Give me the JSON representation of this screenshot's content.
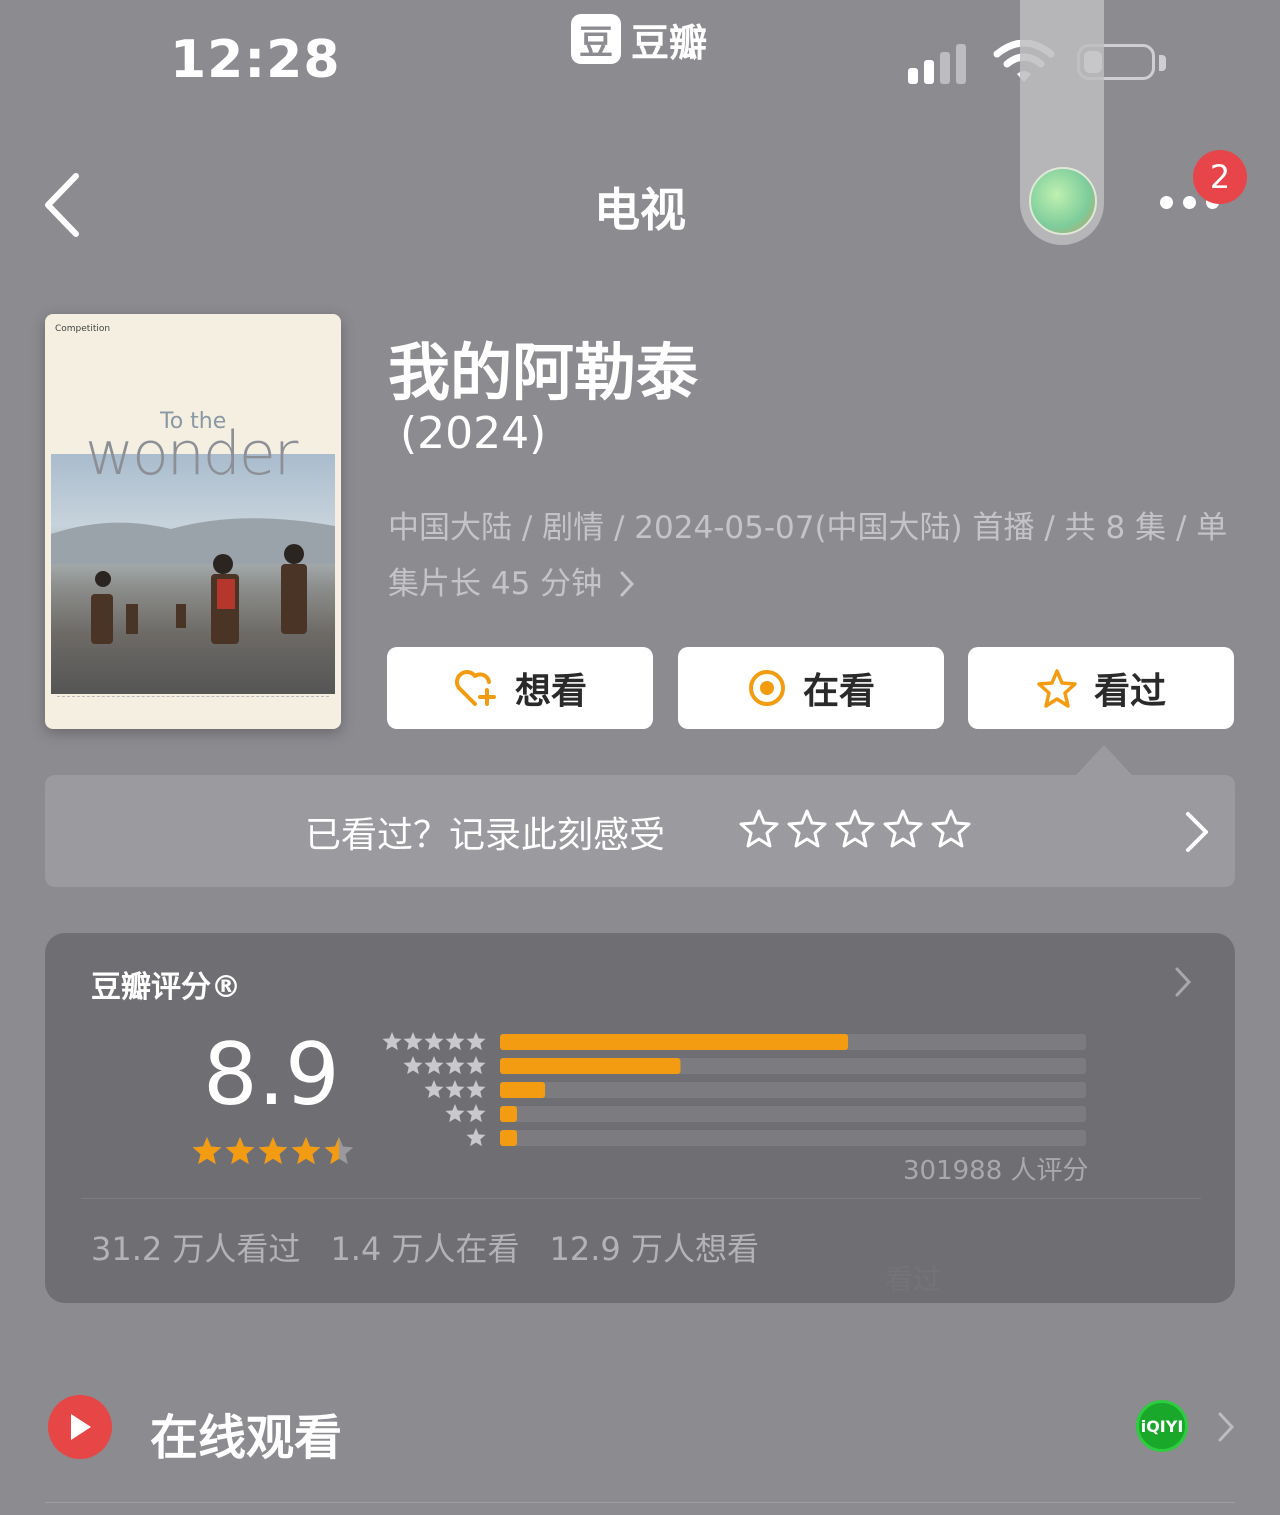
{
  "status_bar": {
    "time": "12:28",
    "app_logo": "豆",
    "app_name": "豆瓣"
  },
  "nav": {
    "title": "电视",
    "notification_count": "2"
  },
  "poster": {
    "festival": "Competition",
    "title_small": "To the",
    "title_big": "wonder"
  },
  "show": {
    "title": "我的阿勒泰",
    "year": "(2024)",
    "meta": "中国大陆 / 剧情 / 2024-05-07(中国大陆) 首播 / 共 8 集 / 单集片长 45 分钟"
  },
  "actions": {
    "want": "想看",
    "watching": "在看",
    "watched": "看过"
  },
  "record": {
    "prompt": "已看过？记录此刻感受"
  },
  "rating": {
    "label": "豆瓣评分®",
    "score": "8.9",
    "stars": 4.5,
    "distribution": [
      {
        "stars": 5,
        "fraction": 0.594
      },
      {
        "stars": 4,
        "fraction": 0.308
      },
      {
        "stars": 3,
        "fraction": 0.077
      },
      {
        "stars": 2,
        "fraction": 0.029
      },
      {
        "stars": 1,
        "fraction": 0.029
      }
    ],
    "count_text": "301988 人评分",
    "watched": "31.2 万人看过",
    "watching": "1.4 万人在看",
    "want": "12.9 万人想看",
    "ghost_text": "看过"
  },
  "watch_online": {
    "label": "在线观看",
    "provider": "iQIYI"
  },
  "colors": {
    "accent": "#f39c12",
    "background": "#8c8b90",
    "card": "#6f6e72"
  }
}
